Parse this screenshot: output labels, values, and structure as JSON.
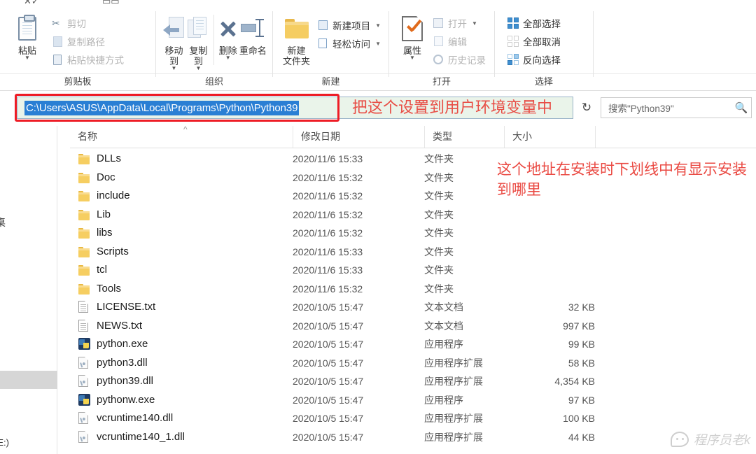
{
  "window": {
    "type": "windows-file-explorer"
  },
  "ribbon": {
    "groups": [
      {
        "label": "剪贴板",
        "big": [
          {
            "label": "粘贴",
            "icon": "clipboard-icon",
            "caret": "▼"
          }
        ],
        "small": [
          {
            "label": "剪切",
            "icon": "scissors-icon",
            "disabled": true
          },
          {
            "label": "复制路径",
            "icon": "copy-path-icon",
            "disabled": true
          },
          {
            "label": "粘贴快捷方式",
            "icon": "paste-shortcut-icon",
            "disabled": true
          }
        ]
      },
      {
        "label": "组织",
        "big": [
          {
            "label": "移动到",
            "icon": "move-to-icon",
            "caret": "▼"
          },
          {
            "label": "复制到",
            "icon": "copy-to-icon",
            "caret": "▼"
          },
          {
            "label": "删除",
            "icon": "delete-x-icon",
            "caret": "▼"
          },
          {
            "label": "重命名",
            "icon": "rename-icon",
            "caret": ""
          }
        ],
        "small": []
      },
      {
        "label": "新建",
        "big": [
          {
            "label": "新建\n文件夹",
            "label_line1": "新建",
            "label_line2": "文件夹",
            "icon": "new-folder-icon",
            "caret": ""
          }
        ],
        "small": [
          {
            "label": "新建项目",
            "icon": "new-item-icon",
            "caret": "▼",
            "disabled": false
          },
          {
            "label": "轻松访问",
            "icon": "easy-access-icon",
            "caret": "▼",
            "disabled": false
          }
        ]
      },
      {
        "label": "打开",
        "big": [
          {
            "label": "属性",
            "icon": "properties-icon",
            "caret": "▼"
          }
        ],
        "small": [
          {
            "label": "打开",
            "icon": "open-icon",
            "caret": "▼",
            "disabled": true
          },
          {
            "label": "编辑",
            "icon": "edit-icon",
            "disabled": true
          },
          {
            "label": "历史记录",
            "icon": "history-icon",
            "disabled": true
          }
        ]
      },
      {
        "label": "选择",
        "big": [],
        "small": [
          {
            "label": "全部选择",
            "icon": "select-all-icon"
          },
          {
            "label": "全部取消",
            "icon": "select-none-icon"
          },
          {
            "label": "反向选择",
            "icon": "invert-selection-icon"
          }
        ]
      }
    ]
  },
  "address_bar": {
    "path": "C:\\Users\\ASUS\\AppData\\Local\\Programs\\Python\\Python39",
    "selected": true,
    "refresh_icon": "↻"
  },
  "search": {
    "placeholder": "搜索\"Python39\"",
    "icon": "search-icon"
  },
  "annotations": [
    {
      "id": "annotation-set-env-var",
      "text": "把这个设置到用户环境变量中",
      "color": "#e8372f"
    },
    {
      "id": "annotation-install-path-note",
      "text": "这个地址在安装时下划线中有显示安装到哪里",
      "color": "#e8372f"
    }
  ],
  "highlight_box": {
    "color": "#ee1c25"
  },
  "columns": [
    {
      "key": "name",
      "label": "名称",
      "sorted": true,
      "sort_caret": "^"
    },
    {
      "key": "date",
      "label": "修改日期"
    },
    {
      "key": "type",
      "label": "类型"
    },
    {
      "key": "size",
      "label": "大小"
    }
  ],
  "files": [
    {
      "name": "DLLs",
      "date": "2020/11/6 15:33",
      "type": "文件夹",
      "size": "",
      "icon": "folder-icon"
    },
    {
      "name": "Doc",
      "date": "2020/11/6 15:32",
      "type": "文件夹",
      "size": "",
      "icon": "folder-icon"
    },
    {
      "name": "include",
      "date": "2020/11/6 15:32",
      "type": "文件夹",
      "size": "",
      "icon": "folder-icon"
    },
    {
      "name": "Lib",
      "date": "2020/11/6 15:32",
      "type": "文件夹",
      "size": "",
      "icon": "folder-icon"
    },
    {
      "name": "libs",
      "date": "2020/11/6 15:32",
      "type": "文件夹",
      "size": "",
      "icon": "folder-icon"
    },
    {
      "name": "Scripts",
      "date": "2020/11/6 15:33",
      "type": "文件夹",
      "size": "",
      "icon": "folder-icon"
    },
    {
      "name": "tcl",
      "date": "2020/11/6 15:33",
      "type": "文件夹",
      "size": "",
      "icon": "folder-icon"
    },
    {
      "name": "Tools",
      "date": "2020/11/6 15:32",
      "type": "文件夹",
      "size": "",
      "icon": "folder-icon"
    },
    {
      "name": "LICENSE.txt",
      "date": "2020/10/5 15:47",
      "type": "文本文档",
      "size": "32 KB",
      "icon": "text-file-icon"
    },
    {
      "name": "NEWS.txt",
      "date": "2020/10/5 15:47",
      "type": "文本文档",
      "size": "997 KB",
      "icon": "text-file-icon"
    },
    {
      "name": "python.exe",
      "date": "2020/10/5 15:47",
      "type": "应用程序",
      "size": "99 KB",
      "icon": "python-exe-icon"
    },
    {
      "name": "python3.dll",
      "date": "2020/10/5 15:47",
      "type": "应用程序扩展",
      "size": "58 KB",
      "icon": "dll-file-icon"
    },
    {
      "name": "python39.dll",
      "date": "2020/10/5 15:47",
      "type": "应用程序扩展",
      "size": "4,354 KB",
      "icon": "dll-file-icon"
    },
    {
      "name": "pythonw.exe",
      "date": "2020/10/5 15:47",
      "type": "应用程序",
      "size": "97 KB",
      "icon": "python-exe-icon"
    },
    {
      "name": "vcruntime140.dll",
      "date": "2020/10/5 15:47",
      "type": "应用程序扩展",
      "size": "100 KB",
      "icon": "dll-file-icon"
    },
    {
      "name": "vcruntime140_1.dll",
      "date": "2020/10/5 15:47",
      "type": "应用程序扩展",
      "size": "44 KB",
      "icon": "dll-file-icon"
    }
  ],
  "nav_pane": {
    "clipped_item_label": "桌",
    "clipped_bottom_label": "(E:)"
  },
  "watermark": {
    "text": "程序员老k",
    "icon": "wechat-bubble-icon"
  }
}
